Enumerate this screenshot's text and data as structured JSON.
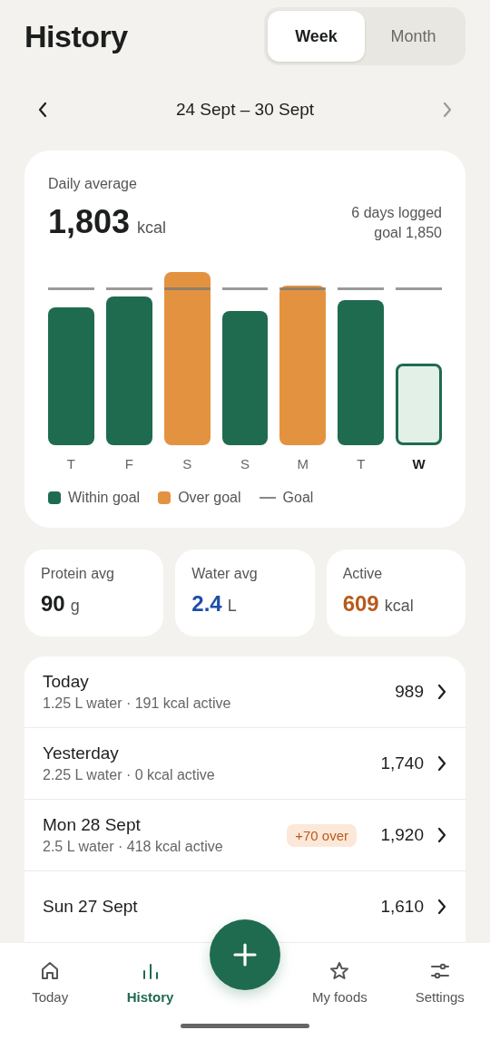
{
  "header": {
    "title": "History"
  },
  "period_tabs": [
    {
      "label": "Week",
      "selected": true
    },
    {
      "label": "Month",
      "selected": false
    }
  ],
  "date_range": {
    "label": "24 Sept – 30 Sept",
    "next_disabled": true
  },
  "summary": {
    "label": "Daily average",
    "value": "1,803",
    "unit": "kcal",
    "logged": "6 days logged",
    "goal": "goal 1,850",
    "days": [
      {
        "label": "T",
        "kind": "within",
        "selected": false
      },
      {
        "label": "F",
        "kind": "within",
        "selected": false
      },
      {
        "label": "S",
        "kind": "over",
        "selected": false
      },
      {
        "label": "S",
        "kind": "within",
        "selected": false
      },
      {
        "label": "M",
        "kind": "over",
        "selected": false
      },
      {
        "label": "T",
        "kind": "within",
        "selected": false
      },
      {
        "label": "W",
        "kind": "today",
        "selected": true
      }
    ],
    "legend": [
      {
        "kind": "within",
        "label": "Within goal"
      },
      {
        "kind": "over",
        "label": "Over goal"
      },
      {
        "kind": "goal",
        "label": "Goal"
      }
    ]
  },
  "stats": [
    {
      "label": "Protein avg",
      "value": "90",
      "unit": "g",
      "color": "#1c1f1d"
    },
    {
      "label": "Water avg",
      "value": "2.4",
      "unit": "L",
      "color": "#1e4fa8"
    },
    {
      "label": "Active",
      "value": "609",
      "unit": "kcal",
      "color": "#b85a1a"
    }
  ],
  "days_list": [
    {
      "title": "Today",
      "subtitle": "1.25 L water · 191 kcal active",
      "value": "989"
    },
    {
      "title": "Yesterday",
      "subtitle": "2.25 L water · 0 kcal active",
      "value": "1,740"
    },
    {
      "title": "Mon 28 Sept",
      "subtitle": "2.5 L water · 418 kcal active",
      "badge": "+70 over",
      "value": "1,920"
    },
    {
      "title": "Sun 27 Sept",
      "value": "1,610"
    }
  ],
  "nav": [
    {
      "kind": "home",
      "label": "Today",
      "selected": false
    },
    {
      "kind": "history",
      "label": "History",
      "selected": true
    },
    {
      "kind": "add"
    },
    {
      "kind": "star",
      "label": "My foods",
      "selected": false
    },
    {
      "kind": "settings",
      "label": "Settings",
      "selected": false
    }
  ]
}
